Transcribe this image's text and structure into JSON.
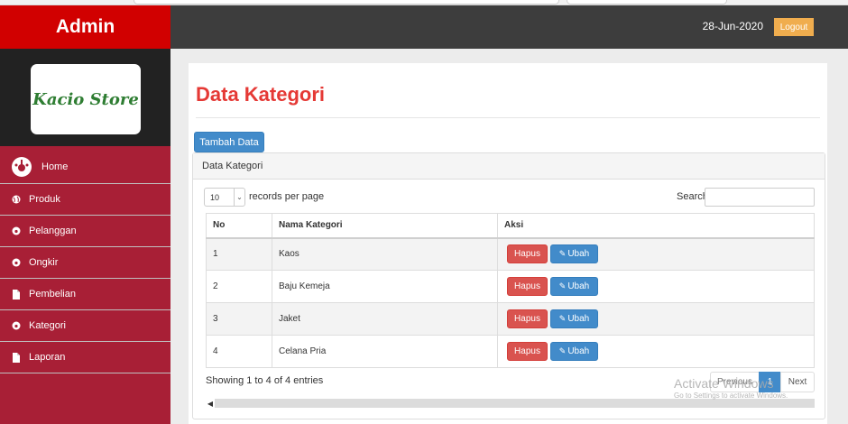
{
  "app": {
    "brand": "Admin",
    "logo_text": "Kacio Store"
  },
  "topbar": {
    "date": "28-Jun-2020",
    "logout_label": "Logout"
  },
  "sidebar": {
    "items": [
      {
        "label": "Home",
        "icon": "dashboard-icon"
      },
      {
        "label": "Produk",
        "icon": "globe-icon"
      },
      {
        "label": "Pelanggan",
        "icon": "dashboard-icon"
      },
      {
        "label": "Ongkir",
        "icon": "dashboard-icon"
      },
      {
        "label": "Pembelian",
        "icon": "file-icon"
      },
      {
        "label": "Kategori",
        "icon": "dashboard-icon"
      },
      {
        "label": "Laporan",
        "icon": "file-icon"
      }
    ]
  },
  "page": {
    "title": "Data Kategori",
    "add_button": "Tambah Data",
    "panel_heading": "Data Kategori"
  },
  "datatable": {
    "length_value": "10",
    "length_label": "records per page",
    "search_label": "Search:",
    "search_value": "",
    "columns": [
      "No",
      "Nama Kategori",
      "Aksi"
    ],
    "rows": [
      {
        "no": "1",
        "nama": "Kaos"
      },
      {
        "no": "2",
        "nama": "Baju Kemeja"
      },
      {
        "no": "3",
        "nama": "Jaket"
      },
      {
        "no": "4",
        "nama": "Celana Pria"
      }
    ],
    "hapus_label": "Hapus",
    "ubah_label": "Ubah",
    "info": "Showing 1 to 4 of 4 entries",
    "pagination": {
      "previous": "Previous",
      "current": "1",
      "next": "Next"
    }
  },
  "watermark": {
    "title": "Activate Windows",
    "subtitle": "Go to Settings to activate Windows."
  },
  "colors": {
    "sidebar_bg": "#a81f36",
    "brand_bg": "#d10000",
    "topbar_bg": "#3d3d3d",
    "title_red": "#e53935",
    "primary": "#428bca",
    "danger": "#d9534f",
    "warning": "#f0ad4e"
  }
}
